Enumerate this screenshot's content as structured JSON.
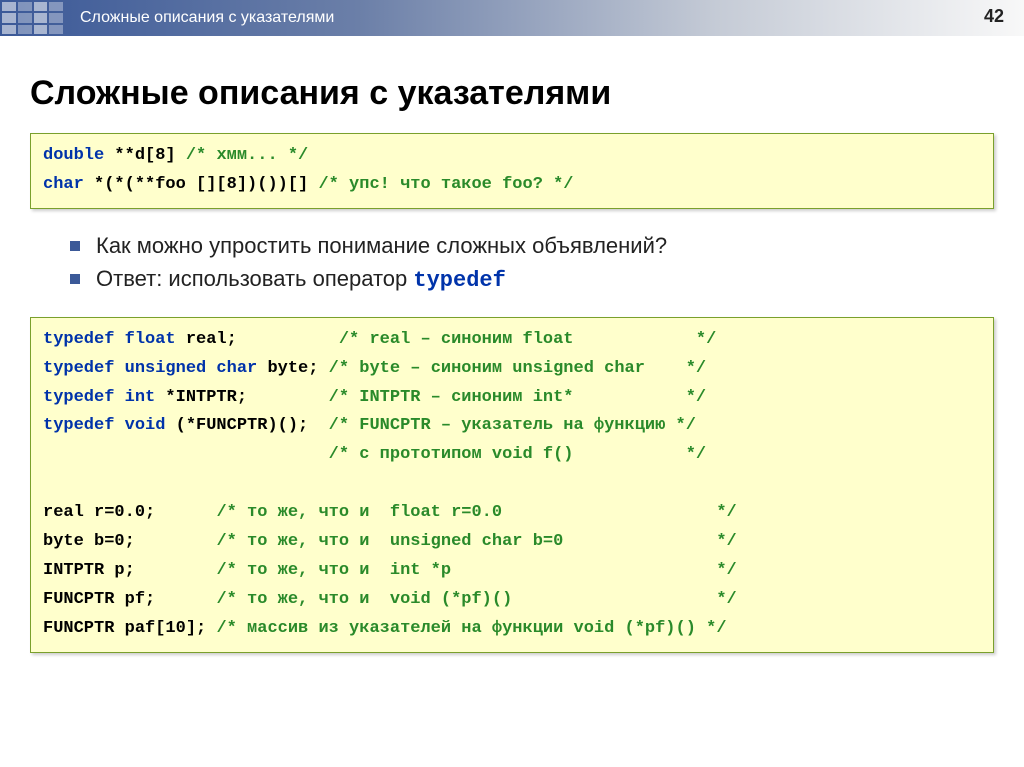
{
  "header": {
    "title": "Сложные описания с указателями",
    "page_number": "42"
  },
  "main_title": "Сложные описания с указателями",
  "code1": {
    "l1_kw": "double",
    "l1_plain": " **d[8] ",
    "l1_cm": "/* хмм... */",
    "l2_kw": "char",
    "l2_plain": " *(*(**foo [][8])())[] ",
    "l2_cm": "/* упс! что такое foo? */"
  },
  "bullets": {
    "b1": "Как можно упростить понимание сложных объявлений?",
    "b2_prefix": "Ответ: использовать оператор ",
    "b2_code": "typedef"
  },
  "code2": {
    "l1": {
      "kw": "typedef float",
      "plain": " real;          ",
      "cm": "/* real – синоним float            */"
    },
    "l2": {
      "kw": "typedef unsigned char",
      "plain": " byte; ",
      "cm": "/* byte – синоним unsigned char    */"
    },
    "l3": {
      "kw": "typedef int",
      "plain": " *INTPTR;        ",
      "cm": "/* INTPTR – синоним int*           */"
    },
    "l4": {
      "kw": "typedef void",
      "plain": " (*FUNCPTR)();  ",
      "cm": "/* FUNCPTR – указатель на функцию */"
    },
    "l5": {
      "plain": "                            ",
      "cm": "/* с прототипом void f()           */"
    },
    "blank": " ",
    "l6": {
      "plain": "real r=0.0;      ",
      "cm": "/* то же, что и  float r=0.0                     */"
    },
    "l7": {
      "plain": "byte b=0;        ",
      "cm": "/* то же, что и  unsigned char b=0               */"
    },
    "l8": {
      "plain": "INTPTR p;        ",
      "cm": "/* то же, что и  int *p                          */"
    },
    "l9": {
      "plain": "FUNCPTR pf;      ",
      "cm": "/* то же, что и  void (*pf)()                    */"
    },
    "l10": {
      "plain": "FUNCPTR paf[10]; ",
      "cm": "/* массив из указателей на функции void (*pf)() */"
    }
  }
}
